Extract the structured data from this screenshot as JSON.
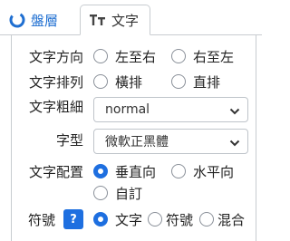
{
  "tabs": [
    {
      "label": "盤層",
      "icon": "disk-layer-icon"
    },
    {
      "label": "文字",
      "icon": "text-icon"
    }
  ],
  "text_direction": {
    "label": "文字方向",
    "options": [
      "左至右",
      "右至左"
    ],
    "selected": null
  },
  "text_arrange": {
    "label": "文字排列",
    "options": [
      "橫排",
      "直排"
    ],
    "selected": null
  },
  "font_weight": {
    "label": "文字粗細",
    "value": "normal"
  },
  "font_face": {
    "label": "字型",
    "value": "微軟正黑體"
  },
  "text_align": {
    "label": "文字配置",
    "options": [
      "垂直向",
      "水平向",
      "自訂"
    ],
    "selected": "垂直向"
  },
  "symbol": {
    "label": "符號",
    "help": "?",
    "options": [
      "文字",
      "符號",
      "混合"
    ],
    "selected": "文字"
  },
  "colors": {
    "accent": "#1e6fe0",
    "border": "#c8ccd0"
  }
}
